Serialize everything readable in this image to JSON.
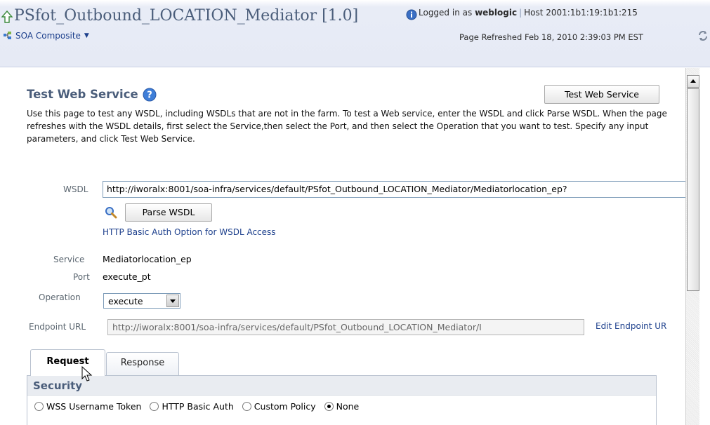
{
  "header": {
    "title": "PSfot_Outbound_LOCATION_Mediator [1.0]",
    "logged_in_prefix": "Logged in as",
    "user": "weblogic",
    "separator": "|",
    "host_label": "Host",
    "host": "2001:1b1:19:1b1:215",
    "menu_label": "SOA Composite",
    "refreshed": "Page Refreshed Feb 18, 2010 2:39:03 PM EST"
  },
  "section": {
    "title": "Test Web Service",
    "test_button": "Test Web Service",
    "description": "Use this page to test any WSDL, including WSDLs that are not in the farm. To test a Web service, enter the WSDL and click Parse WSDL. When the page refreshes with the WSDL details, first select the Service,then select the Port, and then select the Operation that you want to test. Specify any input parameters, and click Test Web Service."
  },
  "form": {
    "wsdl_label": "WSDL",
    "wsdl_value": "http://iworalx:8001/soa-infra/services/default/PSfot_Outbound_LOCATION_Mediator/Mediatorlocation_ep?",
    "parse_button": "Parse WSDL",
    "auth_link": "HTTP Basic Auth Option for WSDL Access",
    "service_label": "Service",
    "service_value": "Mediatorlocation_ep",
    "port_label": "Port",
    "port_value": "execute_pt",
    "operation_label": "Operation",
    "operation_value": "execute",
    "endpoint_label": "Endpoint URL",
    "endpoint_value": "http://iworalx:8001/soa-infra/services/default/PSfot_Outbound_LOCATION_Mediator/I",
    "edit_endpoint": "Edit Endpoint UR"
  },
  "tabs": [
    {
      "label": "Request",
      "active": true
    },
    {
      "label": "Response",
      "active": false
    }
  ],
  "security": {
    "title": "Security",
    "options": [
      {
        "label": "WSS Username Token",
        "selected": false
      },
      {
        "label": "HTTP Basic Auth",
        "selected": false
      },
      {
        "label": "Custom Policy",
        "selected": false
      },
      {
        "label": "None",
        "selected": true
      }
    ]
  },
  "icons": {
    "up": "up-arrow-icon",
    "info": "info-icon",
    "composite": "composite-icon",
    "refresh": "refresh-icon",
    "help": "help-icon",
    "search": "magnifier-icon"
  },
  "colors": {
    "title": "#4a5d7a",
    "link": "#1c3f8c",
    "header_bg": "#e6eaf5"
  }
}
